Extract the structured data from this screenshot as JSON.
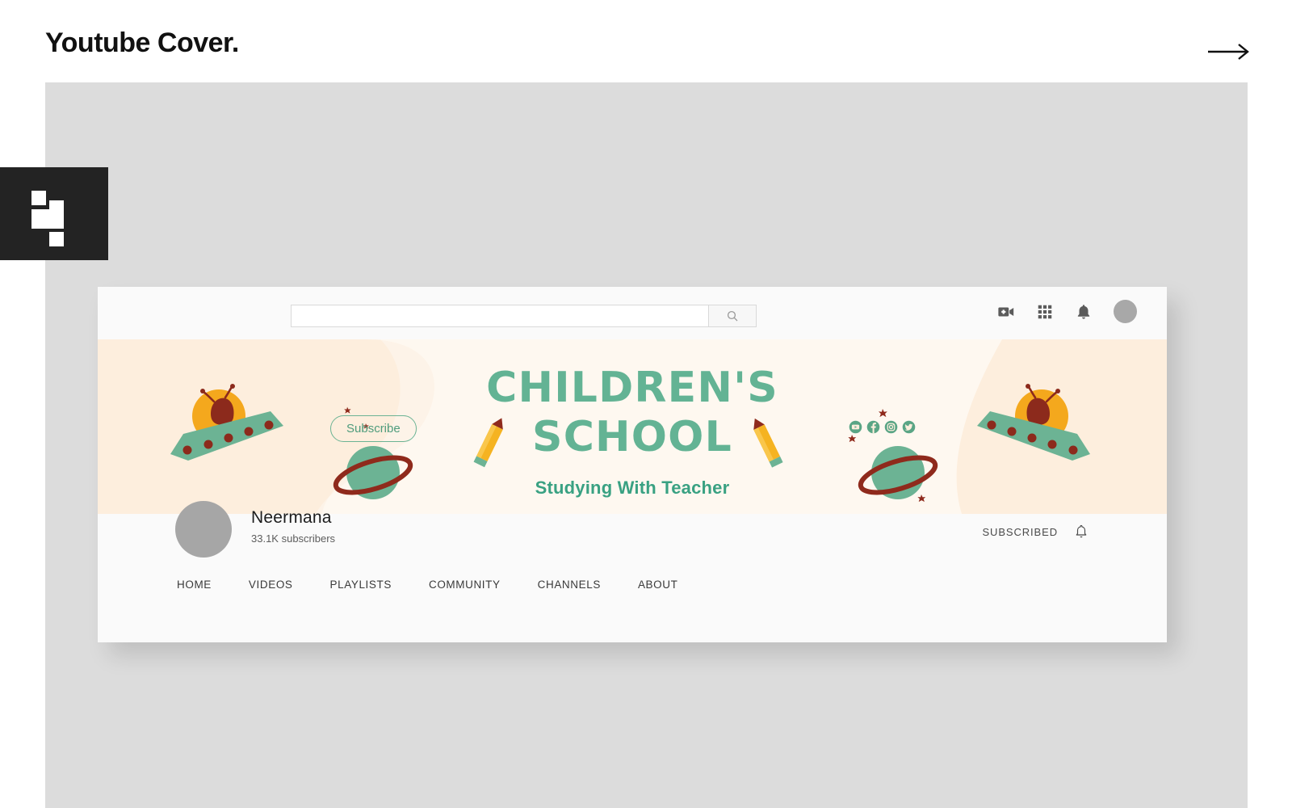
{
  "page": {
    "title": "Youtube Cover.",
    "next_arrow_icon": "arrow-right-icon",
    "brand_logo_icon": "pixel-block-logo-icon",
    "canvas_color": "#dcdcdc",
    "badge_color": "#232323"
  },
  "youtube": {
    "topbar": {
      "search_value": "",
      "search_placeholder": "",
      "search_icon": "search-icon",
      "actions": [
        {
          "icon": "video-camera-plus-icon",
          "name": "create-video-button"
        },
        {
          "icon": "apps-grid-icon",
          "name": "apps-button"
        },
        {
          "icon": "bell-icon",
          "name": "notifications-button"
        }
      ],
      "avatar_icon": "account-avatar",
      "avatar_color": "#a8a8a8"
    },
    "banner": {
      "subscribe_label": "Subscribe",
      "title_line1": "CHILDREN'S",
      "title_line2": "SCHOOL",
      "subtitle": "Studying With Teacher",
      "background_color": "#fdeedd",
      "blob_color": "#fef7ef",
      "accent_green": "#63b394",
      "accent_orange": "#f0a81e",
      "accent_maroon": "#8f2a1c",
      "social": [
        {
          "icon": "youtube-icon",
          "name": "social-youtube"
        },
        {
          "icon": "facebook-icon",
          "name": "social-facebook"
        },
        {
          "icon": "instagram-icon",
          "name": "social-instagram"
        },
        {
          "icon": "twitter-icon",
          "name": "social-twitter"
        }
      ],
      "illustrations": [
        "ufo-left",
        "planet-ring-left",
        "pencil-left",
        "pencil-right",
        "planet-ring-right",
        "ufo-right",
        "stars"
      ]
    },
    "channel": {
      "name": "Neermana",
      "subscribers": "33.1K subscribers",
      "subscribed_label": "SUBSCRIBED",
      "bell_icon": "bell-outline-icon",
      "avatar_color": "#a6a6a6",
      "tabs": [
        {
          "label": "HOME"
        },
        {
          "label": "VIDEOS"
        },
        {
          "label": "PLAYLISTS"
        },
        {
          "label": "COMMUNITY"
        },
        {
          "label": "CHANNELS"
        },
        {
          "label": "ABOUT"
        }
      ]
    }
  }
}
